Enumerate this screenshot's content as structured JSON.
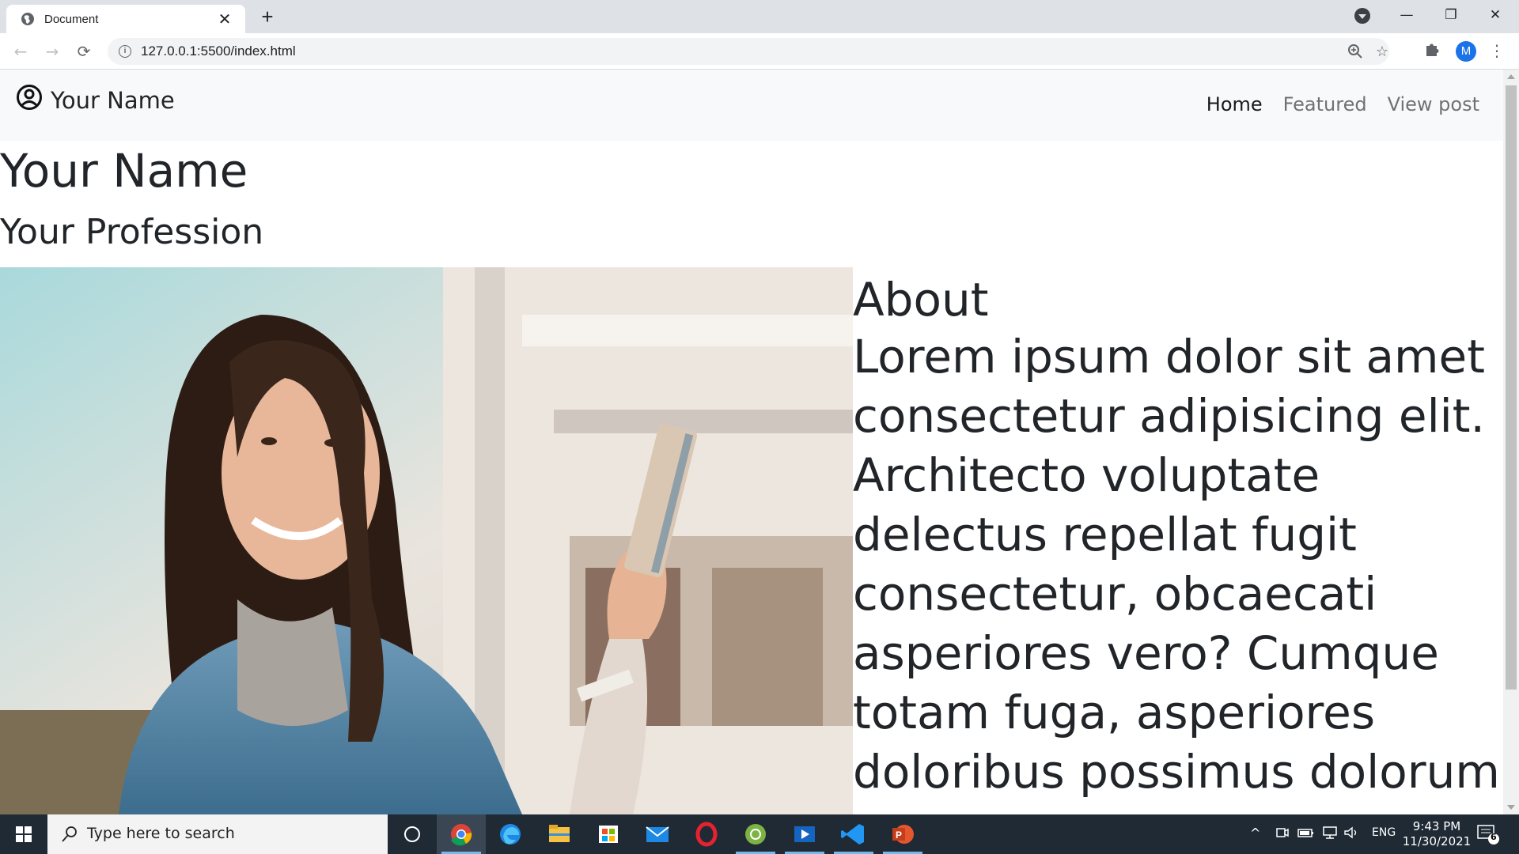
{
  "browser": {
    "tab_title": "Document",
    "tab_close": "✕",
    "new_tab": "+",
    "url": "127.0.0.1:5500/index.html",
    "profile_initial": "M",
    "win_minimize": "—",
    "win_restore": "❐",
    "win_close": "✕"
  },
  "page": {
    "brand": "Your Name",
    "nav": [
      {
        "label": "Home",
        "active": true
      },
      {
        "label": "Featured",
        "active": false
      },
      {
        "label": "View post",
        "active": false
      }
    ],
    "heading": "Your Name",
    "subheading": "Your Profession",
    "about_title": "About",
    "about_text": "Lorem ipsum dolor sit amet consectetur adipisicing elit. Architecto voluptate delectus repellat fugit consectetur, obcaecati asperiores vero? Cumque totam fuga, asperiores doloribus possimus dolorum"
  },
  "taskbar": {
    "search_placeholder": "Type here to search",
    "language": "ENG",
    "time": "9:43 PM",
    "date": "11/30/2021",
    "notification_count": "6",
    "apps": [
      "cortana-icon",
      "chrome-icon",
      "edge-icon",
      "file-explorer-icon",
      "store-icon",
      "mail-icon",
      "opera-icon",
      "app-green-icon",
      "media-player-icon",
      "vscode-icon",
      "powerpoint-icon"
    ]
  }
}
